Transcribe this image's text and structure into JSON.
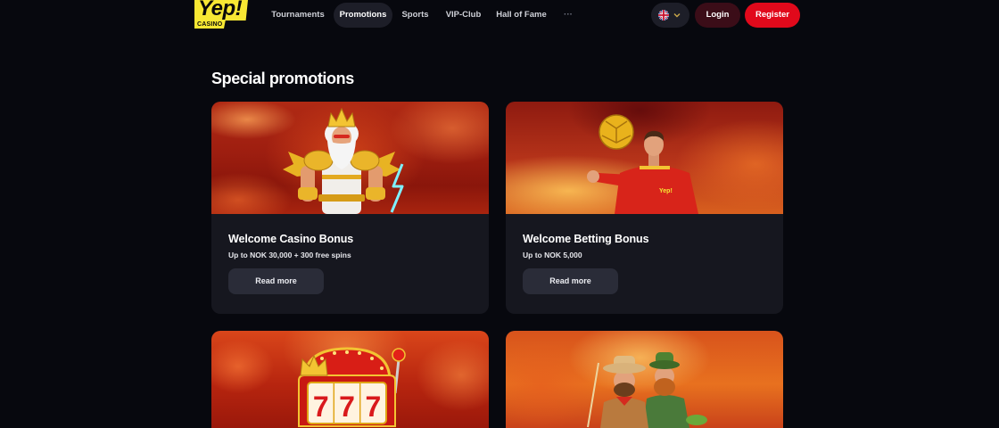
{
  "header": {
    "logo": {
      "text": "Yep!",
      "subtext": "CASINO"
    },
    "nav": {
      "items": [
        {
          "label": "Tournaments",
          "active": false
        },
        {
          "label": "Promotions",
          "active": true
        },
        {
          "label": "Sports",
          "active": false
        },
        {
          "label": "VIP-Club",
          "active": false
        },
        {
          "label": "Hall of Fame",
          "active": false
        }
      ],
      "more": {
        "label": "···",
        "icon": "more-dots-icon"
      }
    },
    "language": {
      "flag_icon": "uk-flag-icon",
      "chevron_icon": "chevron-down-icon"
    },
    "login_label": "Login",
    "register_label": "Register"
  },
  "page": {
    "title": "Special promotions"
  },
  "promotions": [
    {
      "title": "Welcome Casino Bonus",
      "subtitle": "Up to NOK 30,000 + 300 free spins",
      "button_label": "Read more",
      "image": "zeus-illustration"
    },
    {
      "title": "Welcome Betting Bonus",
      "subtitle": "Up to NOK 5,000",
      "button_label": "Read more",
      "image": "football-player-illustration",
      "shirt_text": "Yep!"
    },
    {
      "image": "slot-machine-illustration",
      "reel_symbols": "777"
    },
    {
      "image": "cowboys-illustration"
    }
  ],
  "colors": {
    "page_background": "#07080e",
    "card_background": "#16171f",
    "logo_yellow": "#f7e733",
    "register_button": "#e1091b",
    "login_button": "#3b0d18",
    "read_more_button": "#2a2c38",
    "active_nav": "#1d1e28"
  }
}
